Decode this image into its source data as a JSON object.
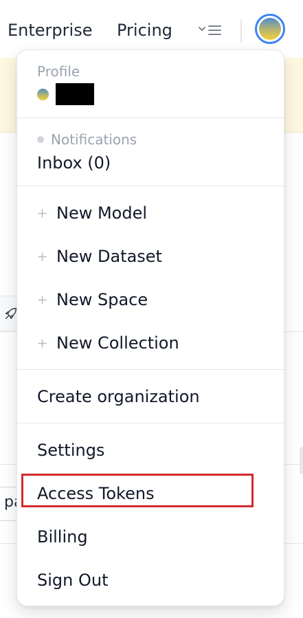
{
  "nav": {
    "enterprise": "Enterprise",
    "pricing": "Pricing",
    "menu_icon": "chevron-list-icon",
    "avatar_icon": "user-avatar"
  },
  "background": {
    "input_partial": "pa",
    "rocket_icon": "rocket-icon"
  },
  "menu": {
    "profile_caption": "Profile",
    "notifications_caption": "Notifications",
    "inbox_label": "Inbox (0)",
    "new_model": "New Model",
    "new_dataset": "New Dataset",
    "new_space": "New Space",
    "new_collection": "New Collection",
    "create_organization": "Create organization",
    "settings": "Settings",
    "access_tokens": "Access Tokens",
    "billing": "Billing",
    "sign_out": "Sign Out"
  },
  "colors": {
    "highlight": "#d42a2a",
    "avatar_ring": "#3b82f6",
    "banner": "#fef8e1"
  }
}
